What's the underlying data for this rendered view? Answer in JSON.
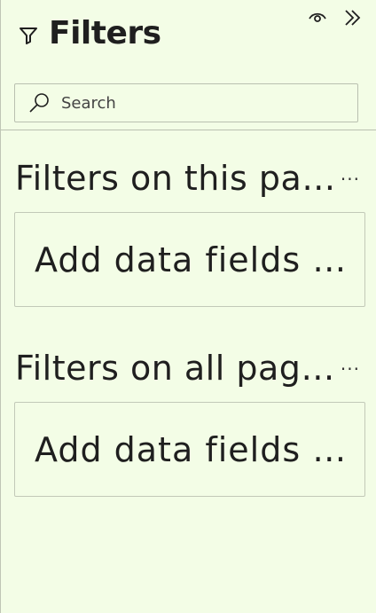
{
  "header": {
    "title": "Filters",
    "filter_icon": "filter-funnel-icon",
    "visibility_icon": "eye-icon",
    "collapse_icon": "double-chevron-right-icon"
  },
  "search": {
    "placeholder": "Search",
    "value": "",
    "icon": "search-icon"
  },
  "sections": [
    {
      "title": "Filters on this page",
      "more_label": "···",
      "well_text": "Add data fields here"
    },
    {
      "title": "Filters on all pages",
      "more_label": "···",
      "well_text": "Add data fields here"
    }
  ],
  "colors": {
    "background": "#f3fde6",
    "border": "#b9c0b0",
    "text": "#1f1f1f"
  }
}
